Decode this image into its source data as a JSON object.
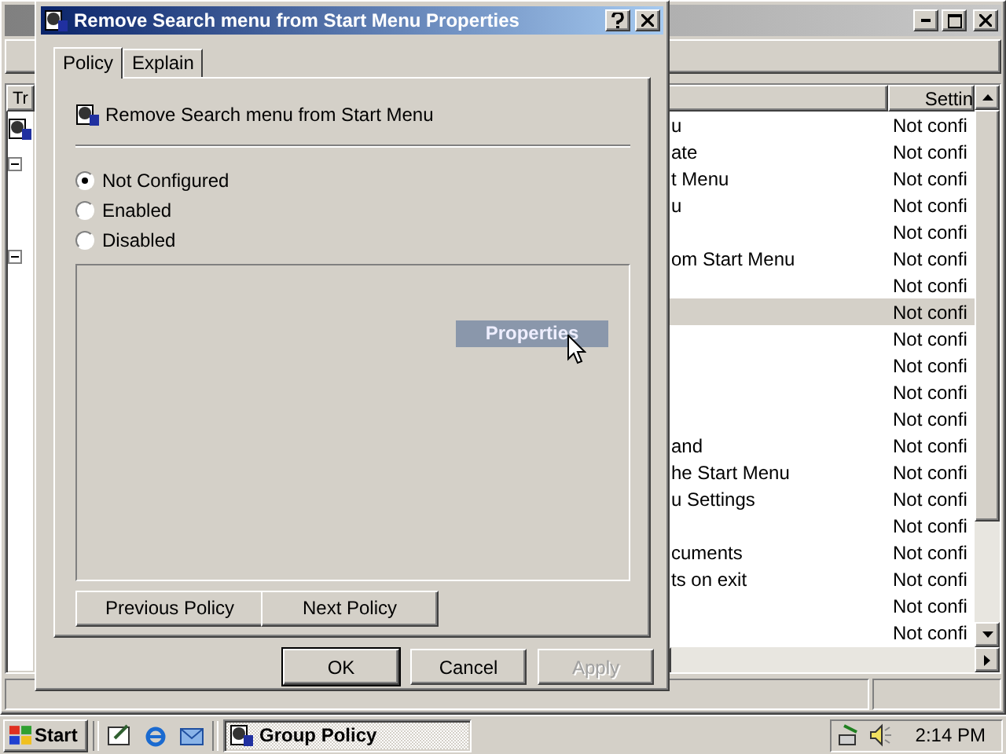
{
  "tree_pane": {
    "header": "Tr"
  },
  "list": {
    "setting_header": "Settin",
    "rows": [
      {
        "name": "u",
        "setting": "Not confi",
        "selected": false
      },
      {
        "name": "ate",
        "setting": "Not confi",
        "selected": false
      },
      {
        "name": "t Menu",
        "setting": "Not confi",
        "selected": false
      },
      {
        "name": "u",
        "setting": "Not confi",
        "selected": false
      },
      {
        "setting": "Not confi",
        "selected": false
      },
      {
        "name": "om Start Menu",
        "setting": "Not confi",
        "selected": false
      },
      {
        "setting": "Not confi",
        "selected": false
      },
      {
        "setting": "Not confi",
        "selected": true
      },
      {
        "setting": "Not confi",
        "selected": false
      },
      {
        "setting": "Not confi",
        "selected": false
      },
      {
        "setting": "Not confi",
        "selected": false
      },
      {
        "setting": "Not confi",
        "selected": false
      },
      {
        "name": "and",
        "setting": "Not confi",
        "selected": false
      },
      {
        "name": "he Start Menu",
        "setting": "Not confi",
        "selected": false
      },
      {
        "name": "u Settings",
        "setting": "Not confi",
        "selected": false
      },
      {
        "setting": "Not confi",
        "selected": false
      },
      {
        "name": "cuments",
        "setting": "Not confi",
        "selected": false
      },
      {
        "name": "ts on exit",
        "setting": "Not confi",
        "selected": false
      },
      {
        "setting": "Not confi",
        "selected": false
      },
      {
        "setting": "Not confi",
        "selected": false
      }
    ]
  },
  "dialog": {
    "title": "Remove Search menu from Start Menu Properties",
    "tabs": [
      {
        "label": "Policy",
        "selected": true
      },
      {
        "label": "Explain",
        "selected": false
      }
    ],
    "policy_name": "Remove Search menu from Start Menu",
    "options": [
      {
        "label": "Not Configured",
        "selected": true
      },
      {
        "label": "Enabled",
        "selected": false
      },
      {
        "label": "Disabled",
        "selected": false
      }
    ],
    "drag_label": "Properties",
    "nav_buttons": [
      "Previous Policy",
      "Next Policy"
    ],
    "buttons": [
      {
        "label": "OK",
        "default": true,
        "disabled": false
      },
      {
        "label": "Cancel",
        "default": false,
        "disabled": false
      },
      {
        "label": "Apply",
        "default": false,
        "disabled": true
      }
    ]
  },
  "taskbar": {
    "start": "Start",
    "tasks": [
      {
        "label": "Group Policy",
        "selected": true
      }
    ],
    "clock": "2:14 PM"
  }
}
